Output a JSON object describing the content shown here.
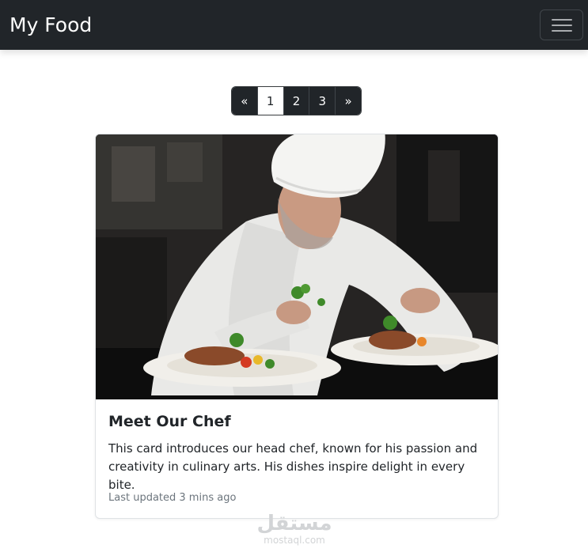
{
  "navbar": {
    "brand": "My Food",
    "toggler_icon": "hamburger-menu-icon"
  },
  "pagination": {
    "prev": "«",
    "pages": [
      "1",
      "2",
      "3"
    ],
    "active_page": "1",
    "next": "»"
  },
  "card": {
    "image_alt": "Chef plating a dish",
    "title": "Meet Our Chef",
    "text": "This card introduces our head chef, known for his passion and creativity in culinary arts. His dishes inspire delight in every bite.",
    "updated": "Last updated 3 mins ago"
  },
  "watermark": {
    "arabic": "مستقل",
    "latin": "mostaql.com"
  },
  "colors": {
    "navbar_bg": "#212529",
    "page_link_bg": "#212529",
    "muted_text": "#6c757d"
  }
}
